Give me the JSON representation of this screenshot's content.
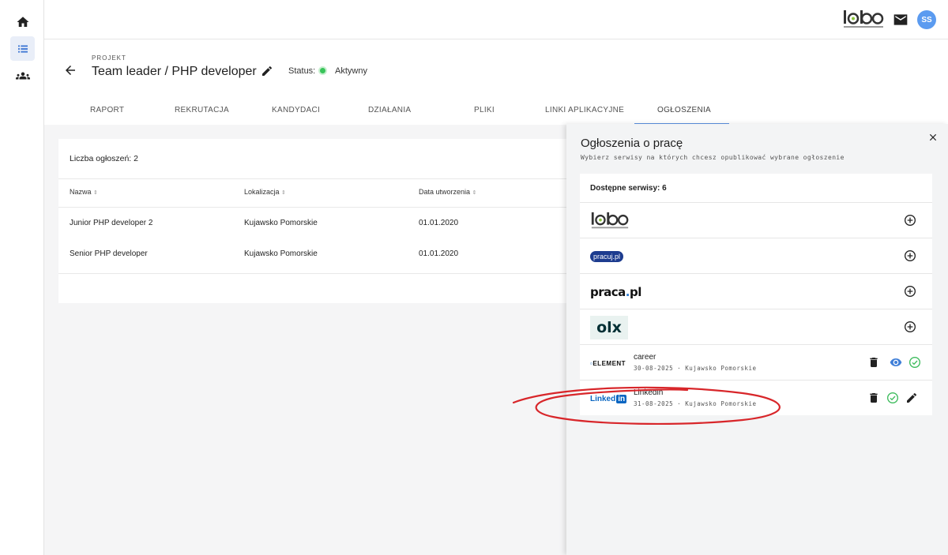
{
  "header": {
    "project_label": "PROJEKT",
    "project_title": "Team leader / PHP developer",
    "status_label": "Status:",
    "status_value": "Aktywny"
  },
  "user": {
    "initials": "SS"
  },
  "tabs": [
    {
      "label": "RAPORT"
    },
    {
      "label": "REKRUTACJA"
    },
    {
      "label": "KANDYDACI"
    },
    {
      "label": "DZIAŁANIA"
    },
    {
      "label": "PLIKI"
    },
    {
      "label": "LINKI APLIKACYJNE"
    },
    {
      "label": "OGŁOSZENIA"
    }
  ],
  "active_tab": "OGŁOSZENIA",
  "table": {
    "count_label": "Liczba ogłoszeń: 2",
    "columns": [
      "Nazwa",
      "Lokalizacja",
      "Data utworzenia"
    ],
    "rows": [
      [
        "Junior PHP developer 2",
        "Kujawsko Pomorskie",
        "01.01.2020"
      ],
      [
        "Senior PHP developer",
        "Kujawsko Pomorskie",
        "01.01.2020"
      ]
    ]
  },
  "panel": {
    "title": "Ogłoszenia o pracę",
    "subtitle": "Wybierz serwisy na których chcesz opublikować wybrane ogłoszenie",
    "available_label": "Dostępne serwisy: 6",
    "services": [
      {
        "name": "lobo"
      },
      {
        "name": "pracuj.pl"
      },
      {
        "name": "praca.pl"
      },
      {
        "name": "olx"
      }
    ],
    "published": [
      {
        "logo": "ELEMENT",
        "name": "career",
        "meta": "30-08-2025 · Kujawsko Pomorskie"
      },
      {
        "logo": "LinkedIn",
        "name": "Linkedin",
        "meta": "31-08-2025 · Kujawsko Pomorskie"
      }
    ]
  },
  "colors": {
    "accent": "#5b8fe0",
    "status_green": "#39c45a",
    "avatar_bg": "#5b9bf0",
    "annotation_red": "#d8262a"
  }
}
